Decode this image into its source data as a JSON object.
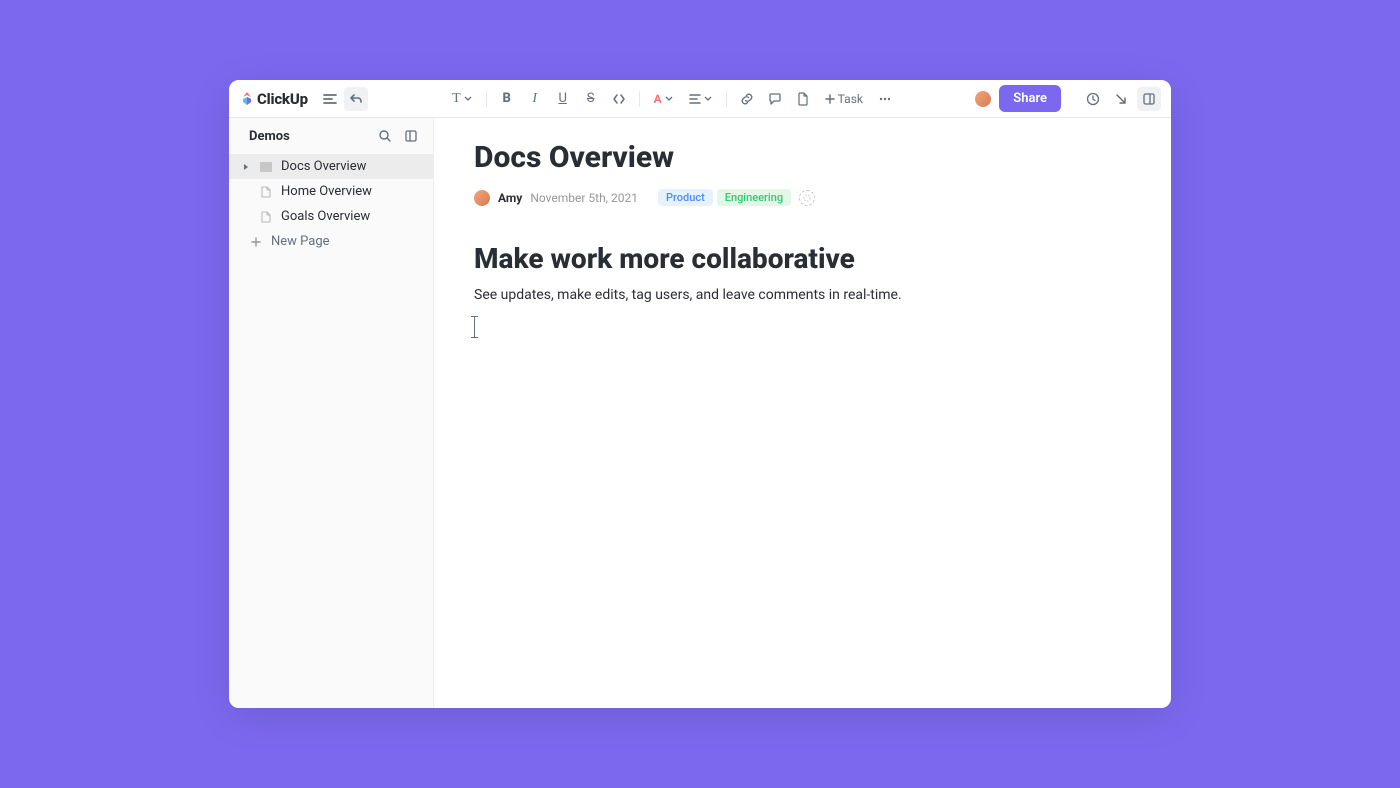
{
  "logo": {
    "text": "ClickUp"
  },
  "toolbar": {
    "textDropdown": "T",
    "bold": "B",
    "task_label": "Task",
    "share_label": "Share",
    "text_color_letter": "A"
  },
  "sidebar": {
    "title": "Demos",
    "items": [
      {
        "label": "Docs Overview",
        "active": true,
        "caret": true,
        "iconType": "bar"
      },
      {
        "label": "Home Overview",
        "active": false,
        "caret": false,
        "iconType": "doc"
      },
      {
        "label": "Goals Overview",
        "active": false,
        "caret": false,
        "iconType": "doc"
      }
    ],
    "new_page_label": "New Page"
  },
  "doc": {
    "title": "Docs Overview",
    "author": "Amy",
    "date": "November 5th, 2021",
    "tags": [
      {
        "label": "Product",
        "class": "product"
      },
      {
        "label": "Engineering",
        "class": "engineering"
      }
    ],
    "heading": "Make work more collaborative",
    "paragraph": "See updates, make edits, tag users, and leave comments in real-time."
  }
}
